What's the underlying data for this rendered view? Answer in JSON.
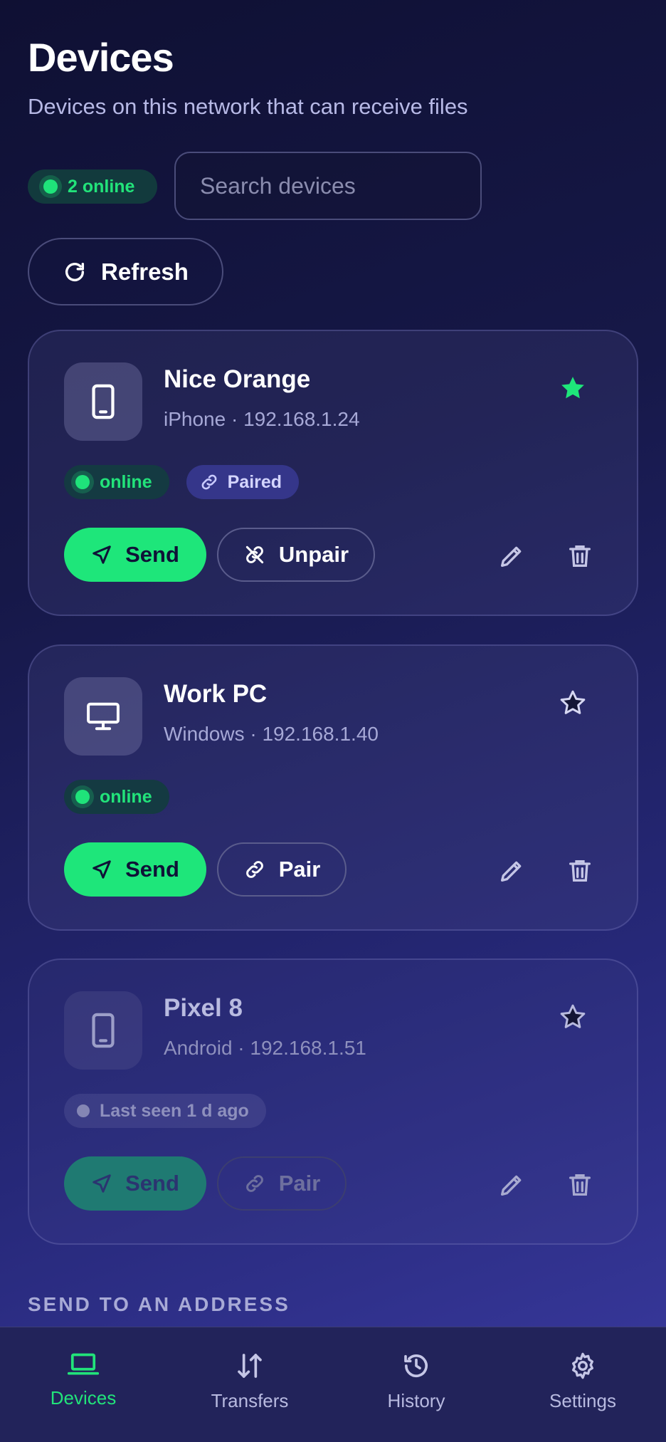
{
  "header": {
    "title": "Devices",
    "subtitle": "Devices on this network that can receive files"
  },
  "toolbar": {
    "online_count": "2 online",
    "search_placeholder": "Search devices",
    "refresh_label": "Refresh"
  },
  "devices": [
    {
      "name": "Nice Orange",
      "meta": "iPhone · 192.168.1.24",
      "type_icon": "phone-icon",
      "favorite": true,
      "status": "online",
      "paired_label": "Paired",
      "send_label": "Send",
      "pair_action_label": "Unpair"
    },
    {
      "name": "Work PC",
      "meta": "Windows · 192.168.1.40",
      "type_icon": "monitor-icon",
      "favorite": false,
      "status": "online",
      "send_label": "Send",
      "pair_action_label": "Pair"
    },
    {
      "name": "Pixel 8",
      "meta": "Android · 192.168.1.51",
      "type_icon": "phone-icon",
      "favorite": false,
      "status": "Last seen 1 d ago",
      "send_label": "Send",
      "pair_action_label": "Pair"
    }
  ],
  "section": {
    "send_to_address": "SEND TO AN ADDRESS"
  },
  "nav": [
    {
      "label": "Devices",
      "icon": "laptop-icon",
      "active": true
    },
    {
      "label": "Transfers",
      "icon": "arrows-updown-icon",
      "active": false
    },
    {
      "label": "History",
      "icon": "history-icon",
      "active": false
    },
    {
      "label": "Settings",
      "icon": "gear-icon",
      "active": false
    }
  ],
  "colors": {
    "accent": "#1ee67a",
    "background": "#161848",
    "card": "#2a2b63"
  }
}
